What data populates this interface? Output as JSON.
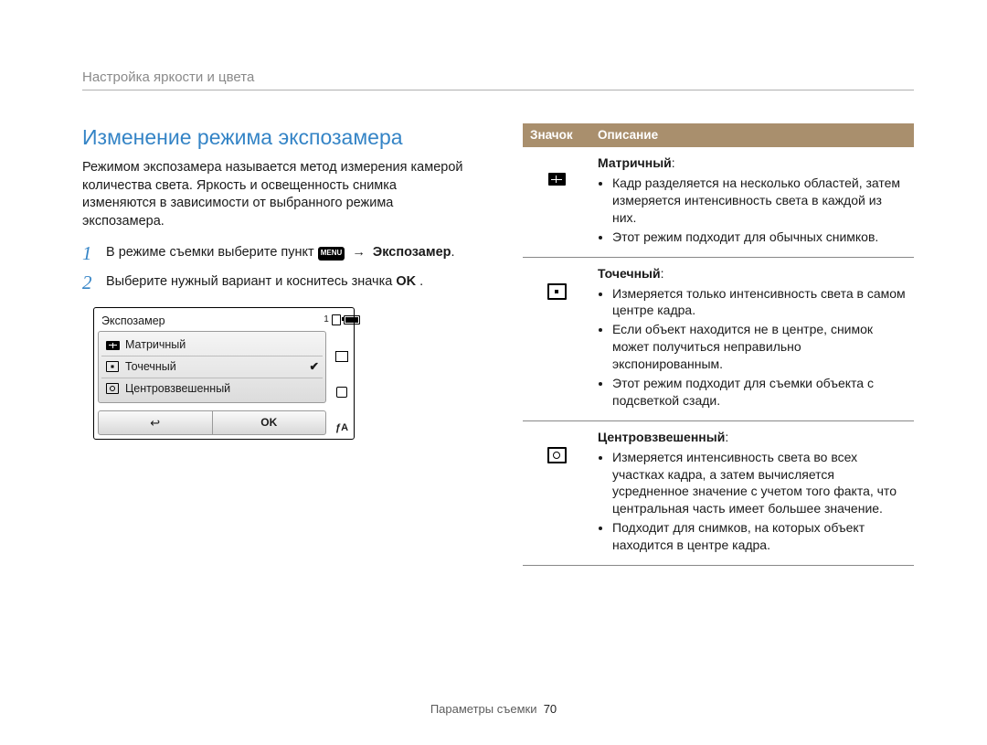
{
  "breadcrumb": "Настройка яркости и цвета",
  "section_title": "Изменение режима экспозамера",
  "intro": "Режимом экспозамера называется метод измерения камерой количества света. Яркость и освещенность снимка изменяются в зависимости от выбранного режима экспозамера.",
  "steps": {
    "one_pre": "В режиме съемки выберите пункт ",
    "one_menu": "MENU",
    "one_arrow": "→",
    "one_target": "Экспозамер",
    "one_post": ".",
    "two_pre": "Выберите нужный вариант и коснитесь значка ",
    "two_ok_a": "O",
    "two_ok_b": "K",
    "two_post": " ."
  },
  "lcd": {
    "title": "Экспозамер",
    "count": "1",
    "opts": {
      "multi": "Матричный",
      "spot": "Точечный",
      "center": "Центровзвешенный"
    },
    "ok": "OK",
    "flash": "ƒA"
  },
  "table": {
    "h_icon": "Значок",
    "h_desc": "Описание",
    "multi": {
      "name": "Матричный",
      "b1": "Кадр разделяется на несколько областей, затем измеряется интенсивность света в каждой из них.",
      "b2": "Этот режим подходит для обычных снимков."
    },
    "spot": {
      "name": "Точечный",
      "b1": "Измеряется только интенсивность света в самом центре кадра.",
      "b2": "Если объект находится не в центре, снимок может получиться неправильно экспонированным.",
      "b3": "Этот режим подходит для съемки объекта с подсветкой сзади."
    },
    "center": {
      "name": "Центровзвешенный",
      "b1": "Измеряется интенсивность света во всех участках кадра, а затем вычисляется усредненное значение с учетом того факта, что центральная часть имеет большее значение.",
      "b2": "Подходит для снимков, на которых объект находится в центре кадра."
    }
  },
  "footer": {
    "label": "Параметры съемки",
    "page": "70"
  }
}
